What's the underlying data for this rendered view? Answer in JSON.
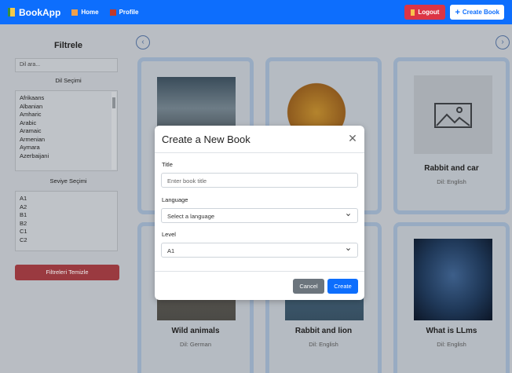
{
  "navbar": {
    "brand": "BookApp",
    "home_label": "Home",
    "profile_label": "Profile",
    "logout_label": "Logout",
    "create_label": "Create Book"
  },
  "sidebar": {
    "title": "Filtrele",
    "search_placeholder": "Dil ara...",
    "language_label": "Dil Seçimi",
    "languages": [
      "Afrikaans",
      "Albanian",
      "Amharic",
      "Arabic",
      "Aramaic",
      "Armenian",
      "Aymara",
      "Azerbaijani"
    ],
    "level_label": "Seviye Seçimi",
    "levels": [
      "A1",
      "A2",
      "B1",
      "B2",
      "C1",
      "C2"
    ],
    "clear_label": "Filtreleri Temizle"
  },
  "carousel": {
    "prev_icon": "chevron-left-icon",
    "next_icon": "chevron-right-icon"
  },
  "books": [
    {
      "title": "",
      "lang": ""
    },
    {
      "title": "",
      "lang": ""
    },
    {
      "title": "Rabbit and car",
      "lang": "Dil: English"
    },
    {
      "title": "Wild animals",
      "lang": "Dil: German"
    },
    {
      "title": "Rabbit and lion",
      "lang": "Dil: English"
    },
    {
      "title": "What is LLms",
      "lang": "Dil: English"
    }
  ],
  "modal": {
    "title": "Create a New Book",
    "title_label": "Title",
    "title_placeholder": "Enter book title",
    "language_label": "Language",
    "language_value": "Select a language",
    "level_label": "Level",
    "level_value": "A1",
    "cancel_label": "Cancel",
    "create_label": "Create"
  },
  "colors": {
    "primary": "#0d6efd",
    "danger": "#dc3545",
    "secondary": "#6c757d"
  }
}
